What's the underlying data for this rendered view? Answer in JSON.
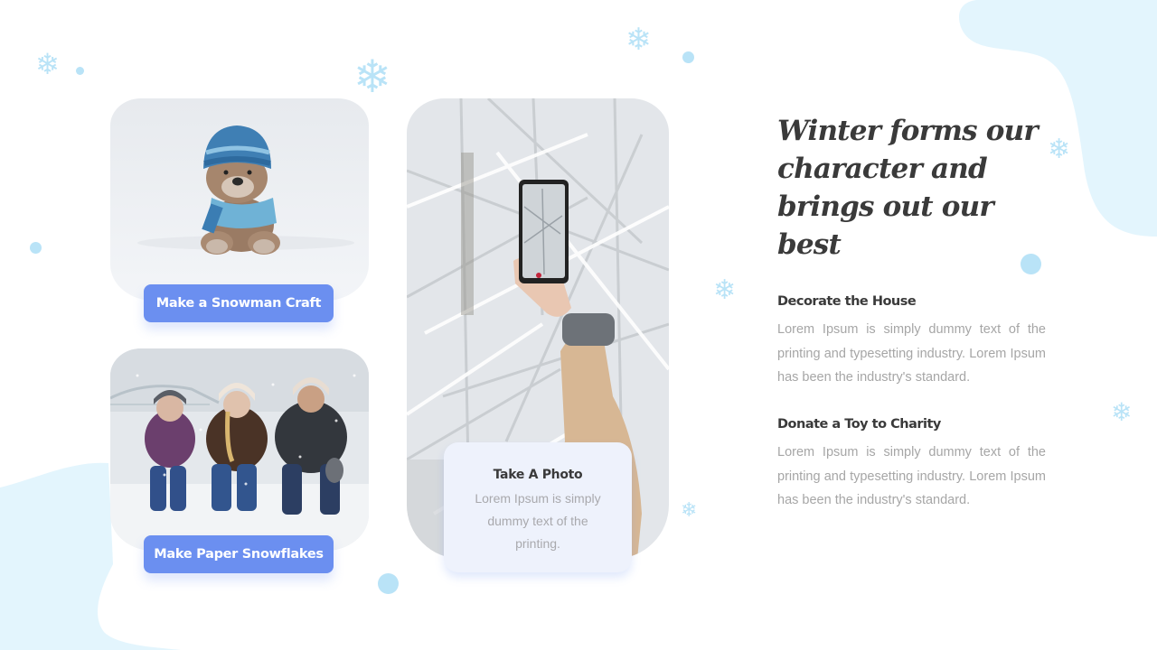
{
  "colors": {
    "accent_button": "#6b8ff0",
    "blob": "#e3f5fd",
    "snowflake": "#b9e3f7",
    "heading_text": "#3a3a3a",
    "body_text": "#a6a6a6",
    "card_bg": "#eef2fc"
  },
  "decorations": {
    "snowflake_glyph": "❄"
  },
  "gallery": {
    "teddy_photo": {
      "alt": "Teddy bear wearing blue knit hat and scarf sitting in snow"
    },
    "family_photo": {
      "alt": "Family sitting in snow during snowfall"
    },
    "phone_photo": {
      "alt": "Hand holding phone photographing snowy branches"
    },
    "buttons": {
      "snowman_label": "Make a Snowman Craft",
      "snowflakes_label": "Make Paper Snowflakes"
    },
    "photo_card": {
      "title": "Take A Photo",
      "body": "Lorem Ipsum is simply dummy text of the printing."
    }
  },
  "content": {
    "headline": "Winter forms our character and brings out our best",
    "sections": [
      {
        "title": "Decorate the House",
        "body": "Lorem Ipsum is simply dummy text of the printing and typesetting industry.  Lorem Ipsum has been the industry's standard."
      },
      {
        "title": "Donate a Toy to Charity",
        "body": "Lorem Ipsum is simply dummy text of the printing and typesetting industry.  Lorem Ipsum has been the industry's standard."
      }
    ]
  }
}
